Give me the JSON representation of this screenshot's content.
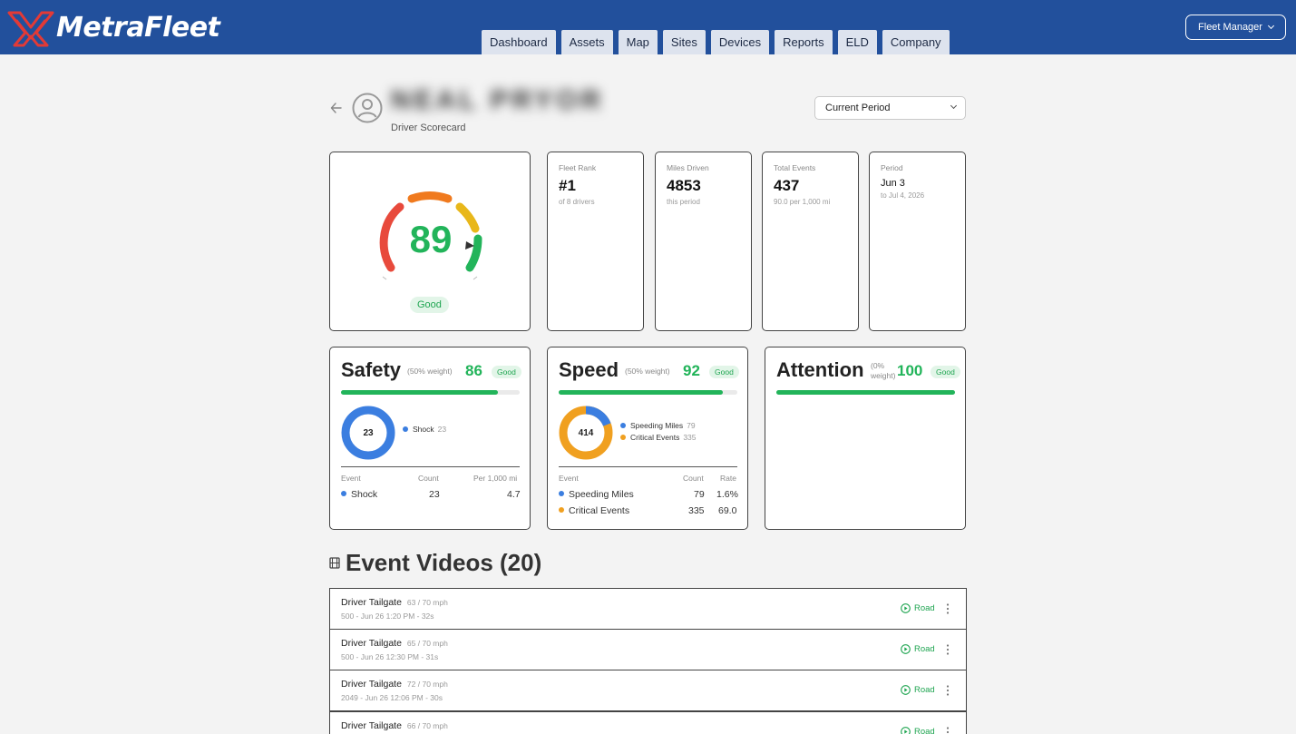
{
  "app": {
    "brand": "MetraFleet"
  },
  "nav": {
    "tabs": [
      "Dashboard",
      "Assets",
      "Map",
      "Sites",
      "Devices",
      "Reports",
      "ELD",
      "Company"
    ]
  },
  "user_menu": {
    "label": "Fleet Manager"
  },
  "header": {
    "driver_name": "NEAL PRYOR",
    "subtitle": "Driver Scorecard",
    "period_select": "Current Period"
  },
  "score": {
    "value": "89",
    "rating": "Good",
    "fraction": 0.89
  },
  "stats": [
    {
      "label": "Fleet Rank",
      "value": "#1",
      "sub": "of 8 drivers"
    },
    {
      "label": "Miles Driven",
      "value": "4853",
      "sub": "this period"
    },
    {
      "label": "Total Events",
      "value": "437",
      "sub": "90.0 per 1,000 mi"
    },
    {
      "label": "Period",
      "value": "Jun 3",
      "sub": "to Jul 4, 2026"
    }
  ],
  "categories": {
    "safety": {
      "title": "Safety",
      "weight": "(50% weight)",
      "score": "86",
      "rating": "Good",
      "fill": 0.88,
      "donut_total": "23",
      "legend": [
        {
          "label": "Shock",
          "count": "23",
          "color": "#3b7ee0"
        }
      ],
      "table_headers": [
        "Event",
        "Count",
        "Per 1,000 mi"
      ],
      "rows": [
        {
          "event": "Shock",
          "count": "23",
          "rate": "4.7",
          "color": "#3b7ee0"
        }
      ]
    },
    "speed": {
      "title": "Speed",
      "weight": "(50% weight)",
      "score": "92",
      "rating": "Good",
      "fill": 0.92,
      "donut_total": "414",
      "legend": [
        {
          "label": "Speeding Miles",
          "count": "79",
          "color": "#3b7ee0"
        },
        {
          "label": "Critical Events",
          "count": "335",
          "color": "#f0a020"
        }
      ],
      "table_headers": [
        "Event",
        "Count",
        "Rate"
      ],
      "rows": [
        {
          "event": "Speeding Miles",
          "count": "79",
          "rate": "1.6%",
          "color": "#3b7ee0"
        },
        {
          "event": "Critical Events",
          "count": "335",
          "rate": "69.0",
          "color": "#f0a020"
        }
      ]
    },
    "attention": {
      "title": "Attention",
      "weight_line1": "(0%",
      "weight_line2": "weight)",
      "score": "100",
      "rating": "Good",
      "fill": 1.0
    }
  },
  "event_videos": {
    "title": "Event Videos (20)",
    "items": [
      {
        "type": "Driver Tailgate",
        "speed": "63 / 70 mph",
        "meta": "500  -  Jun 26 1:20 PM  -  32s",
        "camera": "Road"
      },
      {
        "type": "Driver Tailgate",
        "speed": "65 / 70 mph",
        "meta": "500  -  Jun 26 12:30 PM  -  31s",
        "camera": "Road"
      },
      {
        "type": "Driver Tailgate",
        "speed": "72 / 70 mph",
        "meta": "2049  -  Jun 26 12:06 PM  -  30s",
        "camera": "Road"
      },
      {
        "type": "Driver Tailgate",
        "speed": "66 / 70 mph",
        "meta": "",
        "camera": "Road"
      }
    ]
  },
  "colors": {
    "topbar": "#22509c",
    "good": "#22b45a",
    "blue": "#3b7ee0",
    "orange": "#f0a020"
  }
}
